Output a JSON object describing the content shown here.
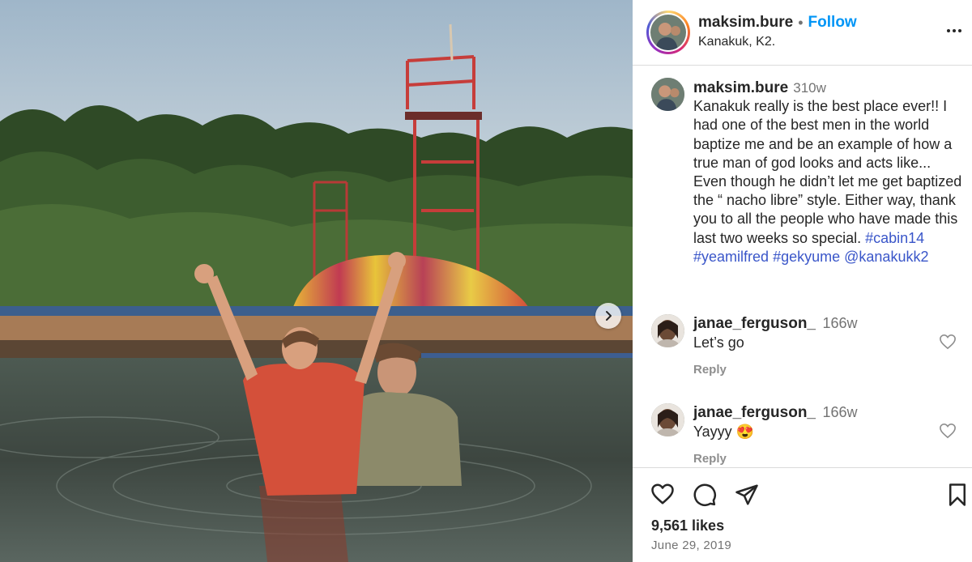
{
  "post": {
    "author": "maksim.bure",
    "follow_label": "Follow",
    "separator": "•",
    "location": "Kanakuk, K2.",
    "caption_time": "310w",
    "caption_text": "Kanakuk really is the best place ever!! I had one of the best men in the world baptize me and be an example of how a true man of god looks and acts like... Even though he didn’t let me get baptized the “ nacho libre” style. Either way, thank you to all the people who have made this last two weeks so special.",
    "caption_tags": [
      "#cabin14",
      "#yeamilfred",
      "#gekyume",
      "@kanakukk2"
    ],
    "likes": "9,561 likes",
    "date": "June 29, 2019"
  },
  "comments": [
    {
      "user": "janae_ferguson_",
      "time": "166w",
      "text": "Let’s go",
      "reply_label": "Reply"
    },
    {
      "user": "janae_ferguson_",
      "time": "166w",
      "text": "Yayyy 😍",
      "reply_label": "Reply"
    }
  ],
  "icons": {
    "more": "more-options-icon",
    "like": "heart-icon",
    "comment": "comment-icon",
    "share": "share-icon",
    "save": "bookmark-icon",
    "next": "chevron-right-icon"
  },
  "colors": {
    "follow": "#0095f6",
    "hashtag": "#3a56c9",
    "secondary_text": "#737373"
  }
}
